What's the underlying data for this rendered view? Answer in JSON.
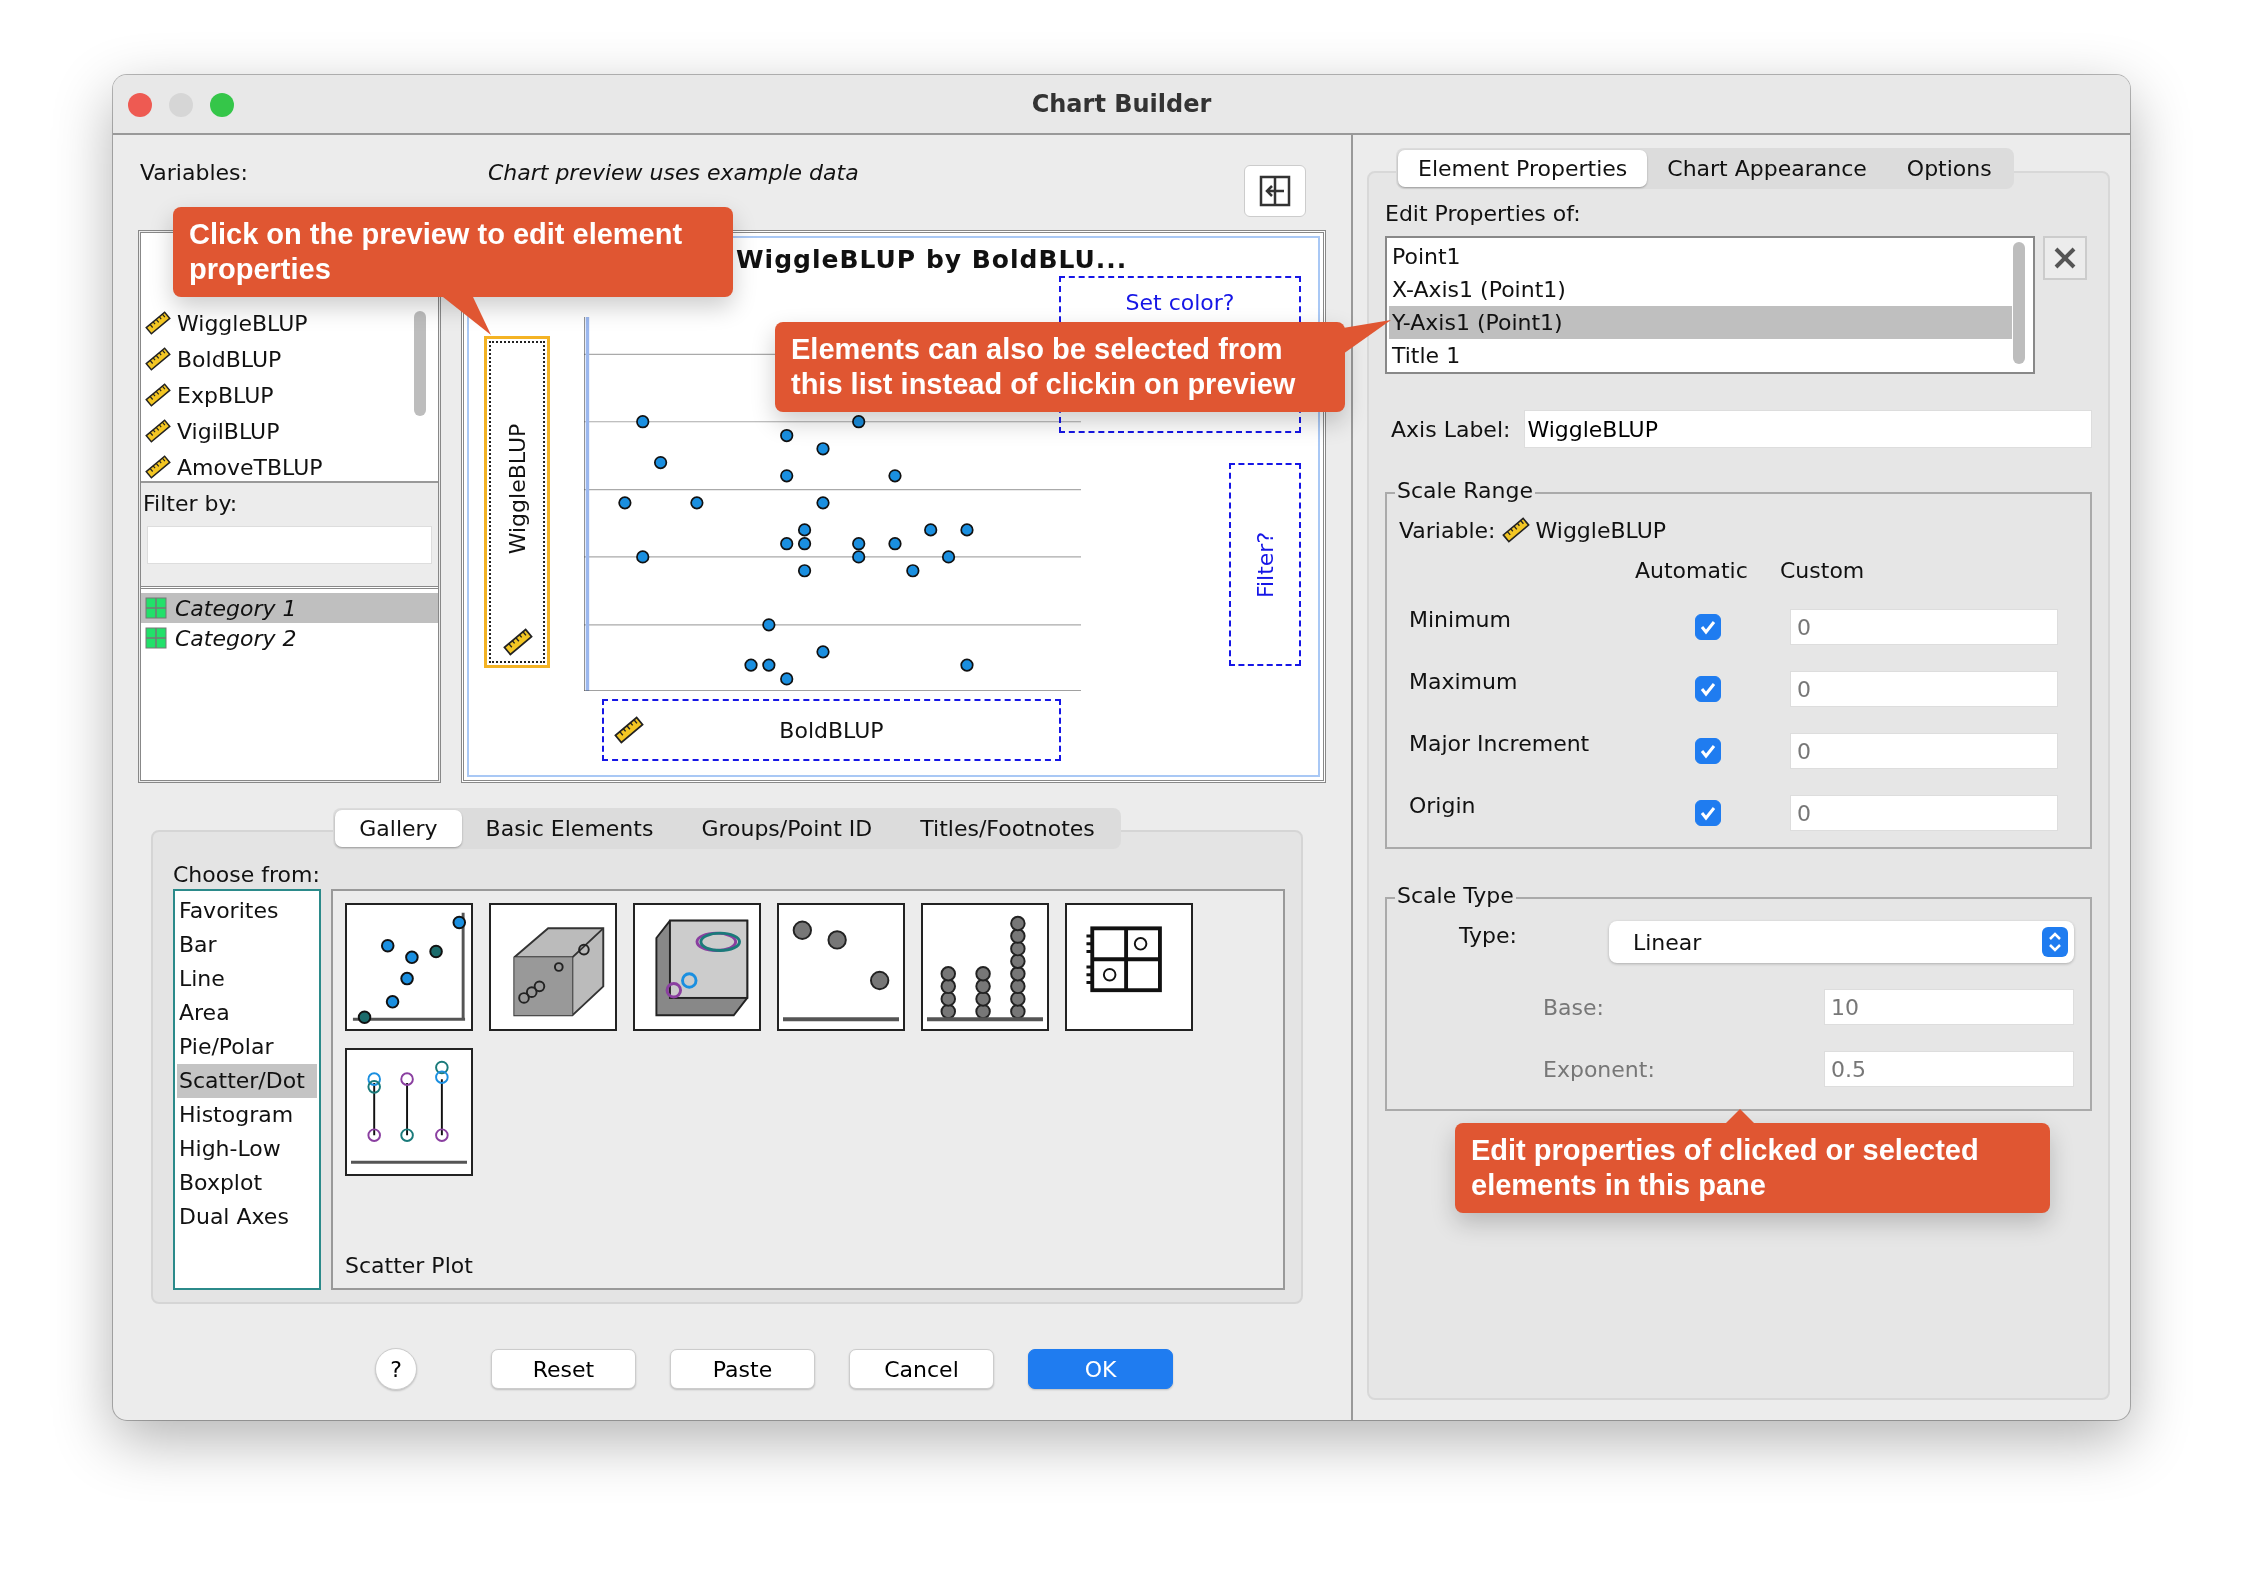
{
  "window": {
    "title": "Chart Builder"
  },
  "variables_label": "Variables:",
  "preview_note": "Chart preview uses example data",
  "variables": [
    "WiggleBLUP",
    "BoldBLUP",
    "ExpBLUP",
    "VigilBLUP",
    "AmoveTBLUP"
  ],
  "filter": {
    "label": "Filter by:",
    "categories": [
      {
        "name": "Category 1",
        "selected": true
      },
      {
        "name": "Category 2",
        "selected": false
      }
    ]
  },
  "preview": {
    "title": "WiggleBLUP by BoldBLU...",
    "y_axis_label": "WiggleBLUP",
    "x_axis_label": "BoldBLUP",
    "color_zone": "Set color?",
    "filter_zone": "Filter?"
  },
  "callouts": [
    "Click on the preview to edit element properties",
    "Elements can also be selected from this list instead of clickin on preview",
    "Edit properties of clicked or selected elements in this pane"
  ],
  "gallery_tabs": [
    {
      "label": "Gallery",
      "selected": true
    },
    {
      "label": "Basic Elements",
      "selected": false
    },
    {
      "label": "Groups/Point ID",
      "selected": false
    },
    {
      "label": "Titles/Footnotes",
      "selected": false
    }
  ],
  "gallery": {
    "choose_label": "Choose from:",
    "types": [
      {
        "label": "Favorites",
        "selected": false
      },
      {
        "label": "Bar",
        "selected": false
      },
      {
        "label": "Line",
        "selected": false
      },
      {
        "label": "Area",
        "selected": false
      },
      {
        "label": "Pie/Polar",
        "selected": false
      },
      {
        "label": "Scatter/Dot",
        "selected": true
      },
      {
        "label": "Histogram",
        "selected": false
      },
      {
        "label": "High-Low",
        "selected": false
      },
      {
        "label": "Boxplot",
        "selected": false
      },
      {
        "label": "Dual Axes",
        "selected": false
      }
    ],
    "thumbnails": [
      {
        "kind": "scatter"
      },
      {
        "kind": "scatter3d"
      },
      {
        "kind": "grouped3d"
      },
      {
        "kind": "dot"
      },
      {
        "kind": "stacked"
      },
      {
        "kind": "matrix"
      },
      {
        "kind": "dropline"
      }
    ],
    "caption": "Scatter Plot"
  },
  "buttons": [
    {
      "label": "?",
      "kind": "help"
    },
    {
      "label": "Reset",
      "kind": "normal"
    },
    {
      "label": "Paste",
      "kind": "normal"
    },
    {
      "label": "Cancel",
      "kind": "normal"
    },
    {
      "label": "OK",
      "kind": "default"
    }
  ],
  "properties": {
    "tabs": [
      {
        "label": "Element Properties",
        "selected": true
      },
      {
        "label": "Chart Appearance",
        "selected": false
      },
      {
        "label": "Options",
        "selected": false
      }
    ],
    "edit_label": "Edit Properties of:",
    "elements": [
      {
        "label": "Point1",
        "selected": false
      },
      {
        "label": "X-Axis1 (Point1)",
        "selected": false
      },
      {
        "label": "Y-Axis1 (Point1)",
        "selected": true
      },
      {
        "label": "Title 1",
        "selected": false
      }
    ],
    "axis_label": {
      "label": "Axis Label:",
      "value": "WiggleBLUP"
    },
    "scale_range": {
      "title": "Scale Range",
      "variable_label": "Variable:",
      "variable": "WiggleBLUP",
      "automatic_header": "Automatic",
      "custom_header": "Custom",
      "rows": [
        {
          "label": "Minimum",
          "checked": true,
          "value": "0"
        },
        {
          "label": "Maximum",
          "checked": true,
          "value": "0"
        },
        {
          "label": "Major Increment",
          "checked": true,
          "value": "0"
        },
        {
          "label": "Origin",
          "checked": true,
          "value": "0"
        }
      ]
    },
    "scale_type": {
      "title": "Scale Type",
      "type_label": "Type:",
      "type": "Linear",
      "base": {
        "label": "Base:",
        "value": "10",
        "disabled": true
      },
      "exponent": {
        "label": "Exponent:",
        "value": "0.5",
        "disabled": true
      }
    }
  }
}
